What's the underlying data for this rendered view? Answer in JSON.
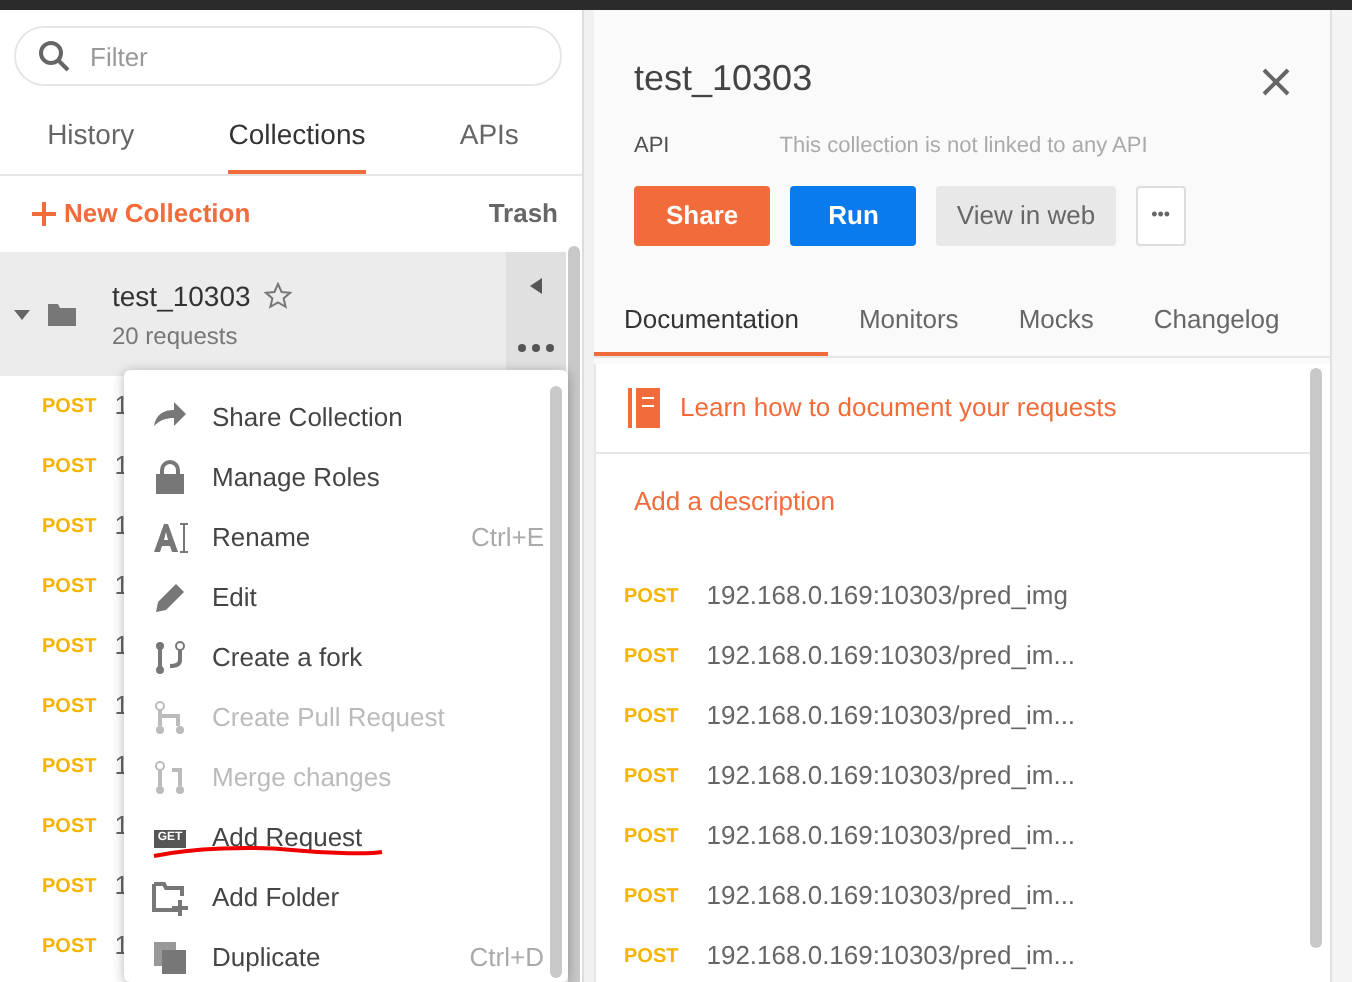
{
  "sidebar": {
    "search": {
      "placeholder": "Filter"
    },
    "tabs": [
      {
        "label": "History",
        "selected": false
      },
      {
        "label": "Collections",
        "selected": true
      },
      {
        "label": "APIs",
        "selected": false
      }
    ],
    "new_collection": "New Collection",
    "trash": "Trash",
    "collection": {
      "name": "test_10303",
      "count": "20 requests",
      "starred": false,
      "expanded": true
    },
    "requests": [
      {
        "method": "POST",
        "url": "1"
      },
      {
        "method": "POST",
        "url": "1"
      },
      {
        "method": "POST",
        "url": "1"
      },
      {
        "method": "POST",
        "url": "1"
      },
      {
        "method": "POST",
        "url": "1"
      },
      {
        "method": "POST",
        "url": "1"
      },
      {
        "method": "POST",
        "url": "1"
      },
      {
        "method": "POST",
        "url": "1"
      },
      {
        "method": "POST",
        "url": "1"
      },
      {
        "method": "POST",
        "url": "1"
      }
    ]
  },
  "context_menu": {
    "items": [
      {
        "label": "Share Collection",
        "disabled": false
      },
      {
        "label": "Manage Roles",
        "disabled": false
      },
      {
        "label": "Rename",
        "shortcut": "Ctrl+E",
        "disabled": false
      },
      {
        "label": "Edit",
        "disabled": false
      },
      {
        "label": "Create a fork",
        "disabled": false
      },
      {
        "label": "Create Pull Request",
        "disabled": true
      },
      {
        "label": "Merge changes",
        "disabled": true
      },
      {
        "label": "Add Request",
        "disabled": false,
        "icon_text": "GET",
        "underlined": true
      },
      {
        "label": "Add Folder",
        "disabled": false
      },
      {
        "label": "Duplicate",
        "shortcut": "Ctrl+D",
        "disabled": false
      }
    ]
  },
  "panel": {
    "title": "test_10303",
    "api_label": "API",
    "api_text": "This collection is not linked to any API",
    "buttons": [
      {
        "label": "Share",
        "kind": "share"
      },
      {
        "label": "Run",
        "kind": "run"
      },
      {
        "label": "View in web",
        "kind": "web"
      },
      {
        "label": "•••",
        "kind": "more"
      }
    ],
    "tabs": [
      {
        "label": "Documentation",
        "selected": true
      },
      {
        "label": "Monitors",
        "selected": false
      },
      {
        "label": "Mocks",
        "selected": false
      },
      {
        "label": "Changelog",
        "selected": false
      }
    ],
    "learn_link": "Learn how to document your requests",
    "add_description": "Add a description",
    "requests": [
      {
        "method": "POST",
        "url": "192.168.0.169:10303/pred_img"
      },
      {
        "method": "POST",
        "url": "192.168.0.169:10303/pred_im..."
      },
      {
        "method": "POST",
        "url": "192.168.0.169:10303/pred_im..."
      },
      {
        "method": "POST",
        "url": "192.168.0.169:10303/pred_im..."
      },
      {
        "method": "POST",
        "url": "192.168.0.169:10303/pred_im..."
      },
      {
        "method": "POST",
        "url": "192.168.0.169:10303/pred_im..."
      },
      {
        "method": "POST",
        "url": "192.168.0.169:10303/pred_im..."
      }
    ]
  }
}
